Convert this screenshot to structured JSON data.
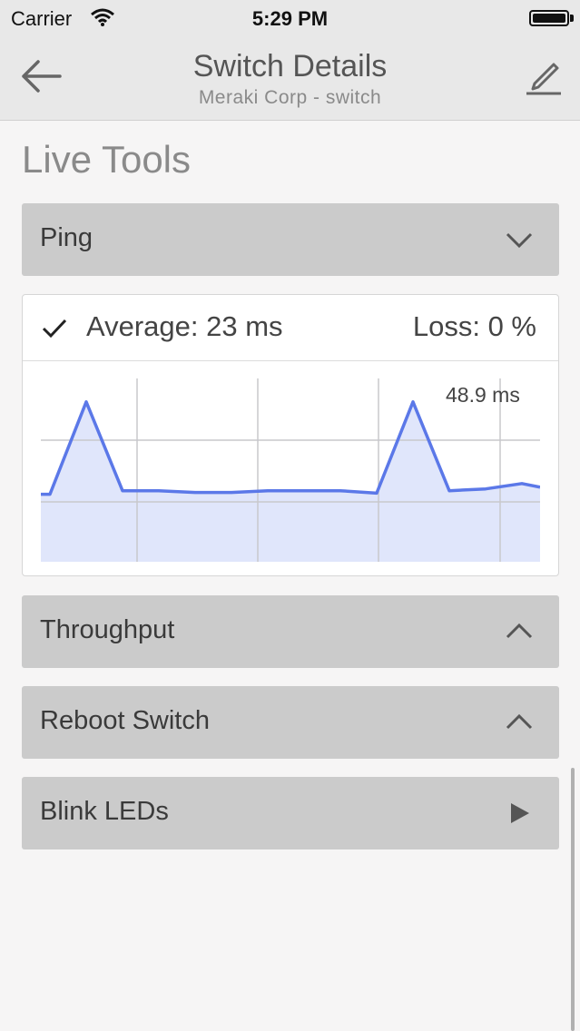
{
  "status_bar": {
    "carrier": "Carrier",
    "time": "5:29 PM",
    "wifi_icon": "wifi-icon",
    "battery_icon": "battery-icon"
  },
  "nav": {
    "title": "Switch Details",
    "subtitle": "Meraki Corp - switch",
    "back_icon": "arrow-left-icon",
    "edit_icon": "pencil-icon"
  },
  "section_title": "Live Tools",
  "tools": [
    {
      "label": "Ping",
      "icon": "chevron-down-icon",
      "expanded": true
    },
    {
      "label": "Throughput",
      "icon": "chevron-up-icon",
      "expanded": false
    },
    {
      "label": "Reboot Switch",
      "icon": "chevron-up-icon",
      "expanded": false
    },
    {
      "label": "Blink LEDs",
      "icon": "play-icon",
      "expanded": false
    }
  ],
  "ping": {
    "average_text": "Average: 23 ms",
    "loss_text": "Loss: 0 %",
    "status_icon": "checkmark-icon"
  },
  "chart_data": {
    "type": "area",
    "peak_label": "48.9 ms",
    "x": [
      0,
      1,
      2,
      3,
      4,
      5,
      6,
      7,
      8,
      9,
      10,
      11,
      12,
      13,
      14
    ],
    "values": [
      23,
      23,
      48.9,
      24,
      24,
      23.5,
      23.5,
      24,
      24,
      24,
      23.3,
      48.9,
      24,
      24.5,
      26,
      25
    ],
    "ylim": [
      0,
      60
    ],
    "color": "#5b78e8",
    "fill_color": "#dde3fb"
  },
  "colors": {
    "accordion_bg": "#cbcbcb",
    "nav_bg": "#e8e8e8",
    "page_bg": "#f6f5f5"
  }
}
